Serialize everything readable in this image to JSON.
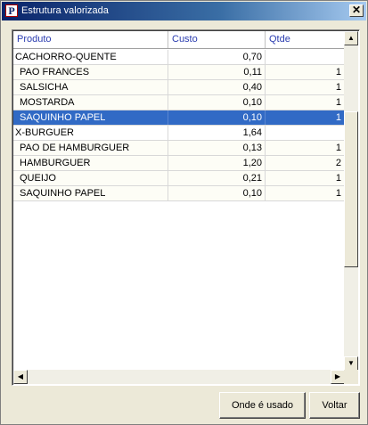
{
  "window": {
    "title": "Estrutura valorizada",
    "close_label": "✕"
  },
  "grid": {
    "columns": [
      "Produto",
      "Custo",
      "Qtde"
    ],
    "rows": [
      {
        "produto": "CACHORRO-QUENTE",
        "custo": "0,70",
        "qtde": "",
        "type": "group"
      },
      {
        "produto": "PAO FRANCES",
        "custo": "0,11",
        "qtde": "1",
        "type": "child"
      },
      {
        "produto": "SALSICHA",
        "custo": "0,40",
        "qtde": "1",
        "type": "child"
      },
      {
        "produto": "MOSTARDA",
        "custo": "0,10",
        "qtde": "1",
        "type": "child"
      },
      {
        "produto": "SAQUINHO PAPEL",
        "custo": "0,10",
        "qtde": "1",
        "type": "child",
        "selected": true
      },
      {
        "produto": "X-BURGUER",
        "custo": "1,64",
        "qtde": "",
        "type": "group"
      },
      {
        "produto": "PAO DE HAMBURGUER",
        "custo": "0,13",
        "qtde": "1",
        "type": "child"
      },
      {
        "produto": "HAMBURGUER",
        "custo": "1,20",
        "qtde": "2",
        "type": "child"
      },
      {
        "produto": "QUEIJO",
        "custo": "0,21",
        "qtde": "1",
        "type": "child"
      },
      {
        "produto": "SAQUINHO PAPEL",
        "custo": "0,10",
        "qtde": "1",
        "type": "child"
      }
    ]
  },
  "buttons": {
    "onde_usado": "Onde é usado",
    "voltar": "Voltar"
  },
  "colors": {
    "title_bar": "#0a246a",
    "selection": "#316ac5",
    "header_text": "#2b3db0"
  }
}
